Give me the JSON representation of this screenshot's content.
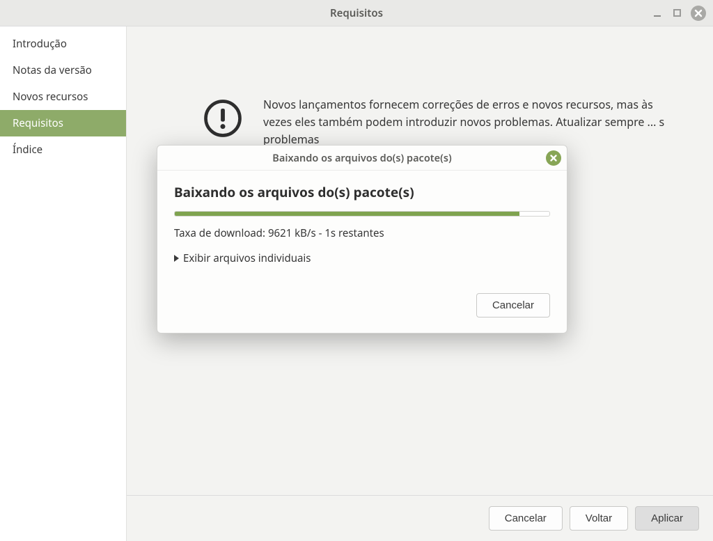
{
  "window": {
    "title": "Requisitos"
  },
  "sidebar": {
    "items": [
      {
        "label": "Introdução",
        "active": false
      },
      {
        "label": "Notas da versão",
        "active": false
      },
      {
        "label": "Novos recursos",
        "active": false
      },
      {
        "label": "Requisitos",
        "active": true
      },
      {
        "label": "Índice",
        "active": false
      }
    ]
  },
  "main": {
    "info_text": "Novos lançamentos fornecem correções de erros e novos recursos, mas às vezes eles também podem introduzir novos problemas. Atualizar sempre ... s problemas"
  },
  "footer": {
    "cancel": "Cancelar",
    "back": "Voltar",
    "apply": "Aplicar"
  },
  "dialog": {
    "title": "Baixando os arquivos do(s) pacote(s)",
    "heading": "Baixando os arquivos do(s) pacote(s)",
    "status": "Taxa de download: 9621 kB/s - 1s restantes",
    "expander_label": "Exibir arquivos individuais",
    "cancel": "Cancelar",
    "progress_percent": 92
  }
}
